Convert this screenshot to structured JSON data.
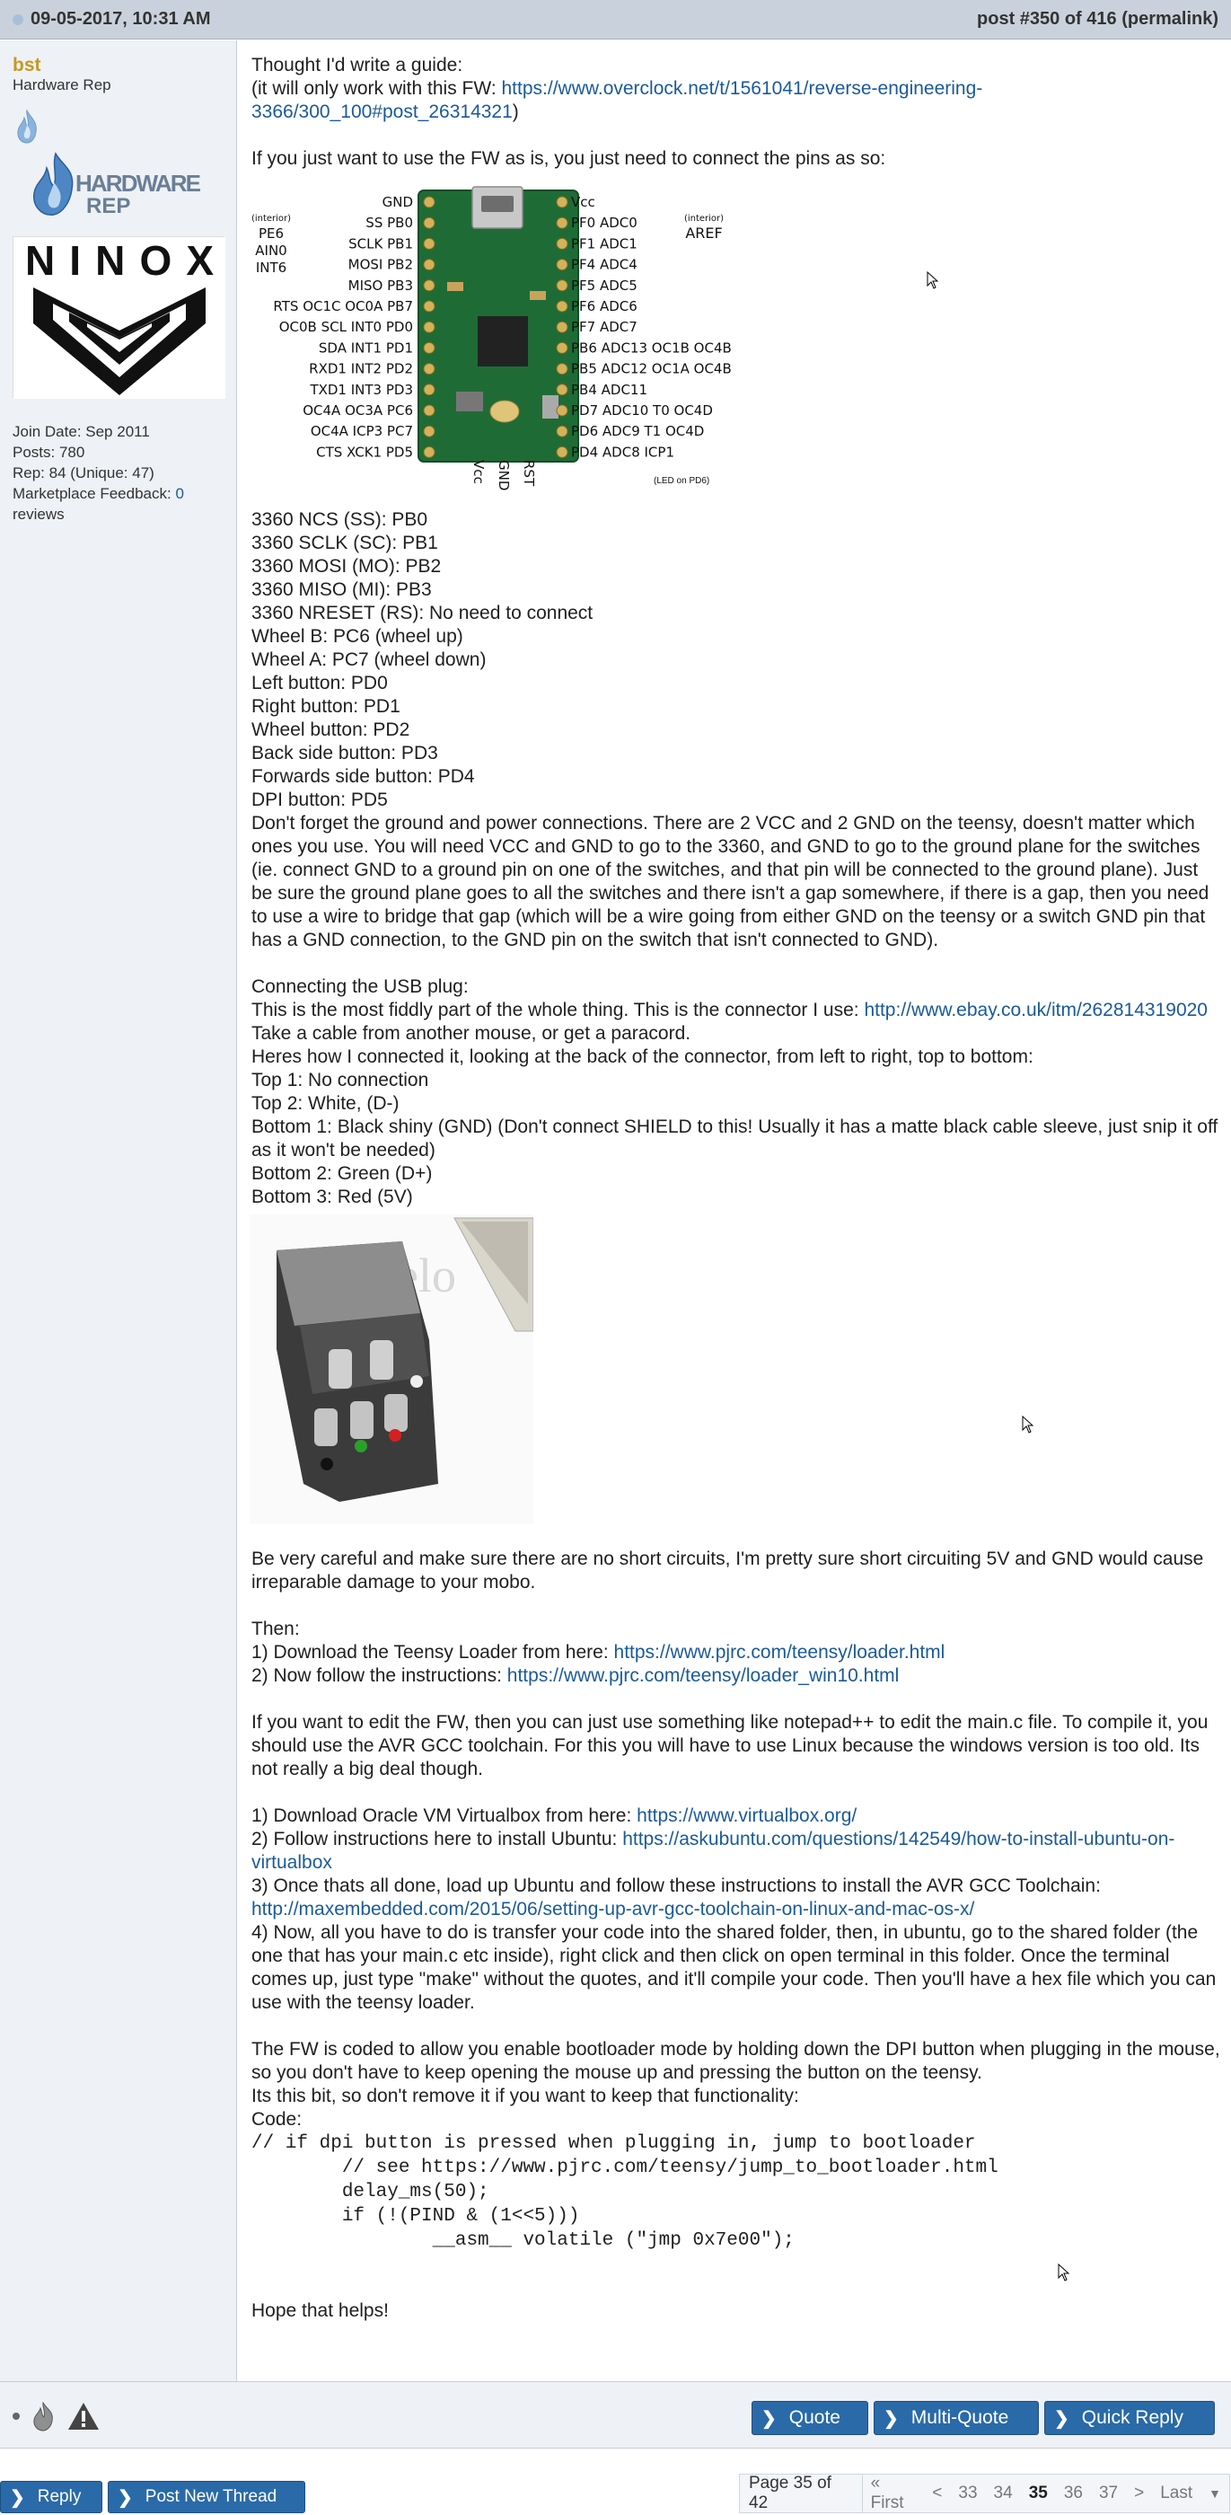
{
  "post": {
    "date": "09-05-2017, 10:31 AM",
    "number": "post #350 of 416 (permalink)"
  },
  "user": {
    "name": "bst",
    "title": "Hardware Rep",
    "badge_text": "HARDWARE REP",
    "join_date": "Join Date: Sep 2011",
    "posts": "Posts: 780",
    "rep": "Rep: 84 (Unique: 47)",
    "marketplace_label": "Marketplace Feedback:",
    "marketplace_count": "0",
    "marketplace_suffix": "reviews",
    "avatar_text": "NINOX"
  },
  "body": {
    "intro1": "Thought I'd write a guide:",
    "intro2_prefix": "(it will only work with this FW: ",
    "intro2_link": "https://www.overclock.net/t/1561041/reverse-engineering-3366/300_100#post_26314321",
    "intro2_suffix": ")",
    "connect_pins": "If you just want to use the FW as is, you just need to connect the pins as so:",
    "pins": [
      "3360 NCS (SS): PB0",
      "3360 SCLK (SC): PB1",
      "3360 MOSI (MO): PB2",
      "3360 MISO (MI): PB3",
      "3360 NRESET (RS): No need to connect",
      "Wheel B: PC6 (wheel up)",
      "Wheel A: PC7 (wheel down)",
      "Left button: PD0",
      "Right button: PD1",
      "Wheel button: PD2",
      "Back side button: PD3",
      "Forwards side button: PD4",
      "DPI button: PD5"
    ],
    "ground_note": "Don't forget the ground and power connections. There are 2 VCC and 2 GND on the teensy, doesn't matter which ones you use. You will need VCC and GND to go to the 3360, and GND to go to the ground plane for the switches (ie. connect GND to a ground pin on one of the switches, and that pin will be connected to the ground plane). Just be sure the ground plane goes to all the switches and there isn't a gap somewhere, if there is a gap, then you need to use a wire to bridge that gap (which will be a wire going from either GND on the teensy or a switch GND pin that has a GND connection, to the GND pin on the switch that isn't connected to GND).",
    "usb_title": "Connecting the USB plug:",
    "usb_connector_prefix": "This is the most fiddly part of the whole thing. This is the connector I use: ",
    "usb_connector_link": "http://www.ebay.co.uk/itm/262814319020",
    "usb_lines": [
      "Take a cable from another mouse, or get a paracord.",
      "Heres how I connected it, looking at the back of the connector, from left to right, top to bottom:",
      "Top 1: No connection",
      "Top 2: White, (D-)",
      "Bottom 1: Black shiny (GND) (Don't connect SHIELD to this! Usually it has a matte black cable sleeve, just snip it off as it won't be needed)",
      "Bottom 2: Green (D+)",
      "Bottom 3: Red (5V)"
    ],
    "careful": "Be very careful and make sure there are no short circuits, I'm pretty sure short circuiting 5V and GND would cause irreparable damage to your mobo.",
    "then": "Then:",
    "step1_prefix": "1) Download the Teensy Loader from here: ",
    "step1_link": "https://www.pjrc.com/teensy/loader.html",
    "step2_prefix": "2) Now follow the instructions: ",
    "step2_link": "https://www.pjrc.com/teensy/loader_win10.html",
    "edit_fw": "If you want to edit the FW, then you can just use something like notepad++ to edit the main.c file. To compile it, you should use the AVR GCC toolchain. For this you will have to use Linux because the windows version is too old. Its not really a big deal though.",
    "vm1_prefix": "1) Download Oracle VM Virtualbox from here: ",
    "vm1_link": "https://www.virtualbox.org/",
    "vm2_prefix": "2) Follow instructions here to install Ubuntu: ",
    "vm2_link": "https://askubuntu.com/questions/142549/how-to-install-ubuntu-on-virtualbox",
    "vm3_text": "3) Once thats all done, load up Ubuntu and follow these instructions to install the AVR GCC Toolchain:",
    "vm3_link": "http://maxembedded.com/2015/06/setting-up-avr-gcc-toolchain-on-linux-and-mac-os-x/",
    "vm4": "4) Now, all you have to do is transfer your code into the shared folder, then, in ubuntu, go to the shared folder (the one that has your main.c etc inside), right click and then click on open terminal in this folder. Once the terminal comes up, just type \"make\" without the quotes, and it'll compile your code. Then you'll have a hex file which you can use with the teensy loader.",
    "bootloader1": "The FW is coded to allow you enable bootloader mode by holding down the DPI button when plugging in the mouse, so you don't have to keep opening the mouse up and pressing the button on the teensy.",
    "bootloader2": "Its this bit, so don't remove it if you want to keep that functionality:",
    "code_label": "Code:",
    "code": "// if dpi button is pressed when plugging in, jump to bootloader\n        // see https://www.pjrc.com/teensy/jump_to_bootloader.html\n        delay_ms(50);\n        if (!(PIND & (1<<5)))\n                __asm__ volatile (\"jmp 0x7e00\");",
    "closing": "Hope that helps!"
  },
  "pinout": {
    "left_labels": [
      "GND",
      "SS PB0",
      "SCLK PB1",
      "MOSI PB2",
      "MISO PB3",
      "RTS OC1C OC0A PB7",
      "OC0B SCL INT0 PD0",
      "SDA INT1 PD1",
      "RXD1 INT2 PD2",
      "TXD1 INT3 PD3",
      "OC4A OC3A PC6",
      "OC4A ICP3 PC7",
      "CTS XCK1 PD5"
    ],
    "left_interior": [
      "(interior)",
      "PE6",
      "AIN0",
      "INT6"
    ],
    "right_labels": [
      "Vcc",
      "PF0 ADC0",
      "PF1 ADC1",
      "PF4 ADC4",
      "PF5 ADC5",
      "PF6 ADC6",
      "PF7 ADC7",
      "PB6 ADC13 OC1B OC4B",
      "PB5 ADC12 OC1A OC4B",
      "PB4 ADC11",
      "PD7 ADC10 T0 OC4D",
      "PD6 ADC9 T1 OC4D",
      "PD4 ADC8 ICP1"
    ],
    "right_interior": [
      "(interior)",
      "AREF"
    ],
    "bottom_labels": [
      "Vcc",
      "GND",
      "RST"
    ],
    "led_note": "(LED on PD6)"
  },
  "plug_watermark": "mmelo",
  "actions": {
    "quote": "Quote",
    "multi_quote": "Multi-Quote",
    "quick_reply": "Quick Reply",
    "reply": "Reply",
    "new_thread": "Post New Thread"
  },
  "pager": {
    "label": "Page 35 of 42",
    "first": "« First",
    "prev": "<",
    "pages": [
      "33",
      "34",
      "35",
      "36",
      "37"
    ],
    "current": "35",
    "next": ">",
    "last": "Last"
  },
  "colors": {
    "header_bg": "#c9d2dc",
    "sidebar_bg": "#eef1f5",
    "link": "#1a5a9a",
    "username": "#c79a1d",
    "button": "#2a6aa8"
  }
}
